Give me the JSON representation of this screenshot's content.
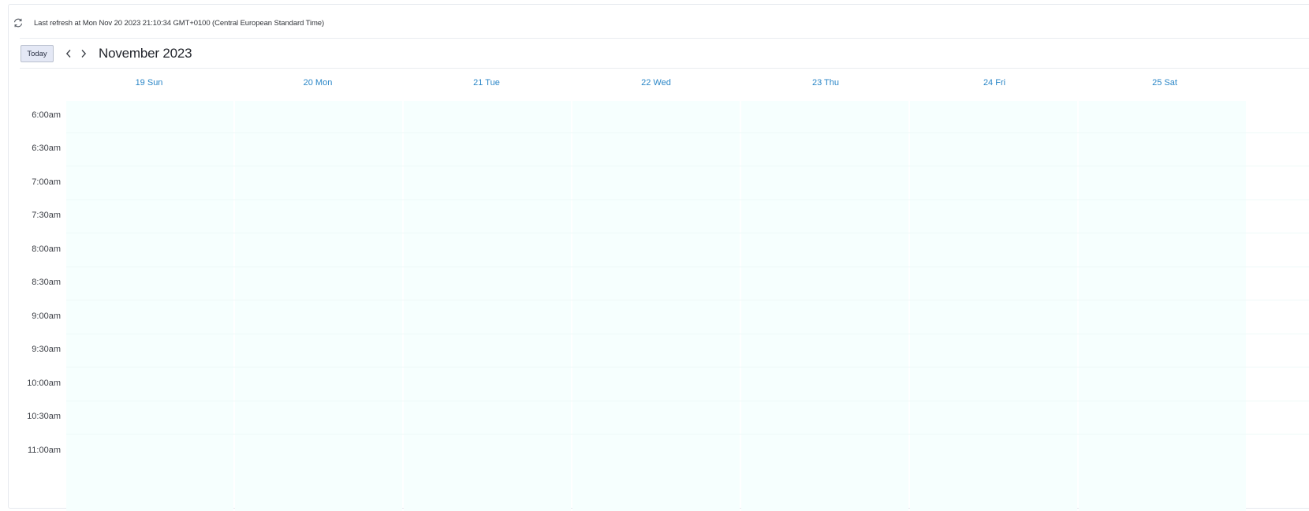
{
  "refresh": {
    "icon": "refresh-icon",
    "text": "Last refresh at Mon Nov 20 2023 21:10:34 GMT+0100 (Central European Standard Time)"
  },
  "toolbar": {
    "today_label": "Today",
    "prev_icon": "chevron-left-icon",
    "next_icon": "chevron-right-icon",
    "month_title": "November 2023"
  },
  "days": [
    "19 Sun",
    "20 Mon",
    "21 Tue",
    "22 Wed",
    "23 Thu",
    "24 Fri",
    "25 Sat"
  ],
  "times": [
    "6:00am",
    "6:30am",
    "7:00am",
    "7:30am",
    "8:00am",
    "8:30am",
    "9:00am",
    "9:30am",
    "10:00am",
    "10:30am",
    "11:00am"
  ],
  "colors": {
    "accent": "#2a86c7",
    "slot_background": "#f6fffe",
    "today_button_bg": "#e4e8f5"
  }
}
